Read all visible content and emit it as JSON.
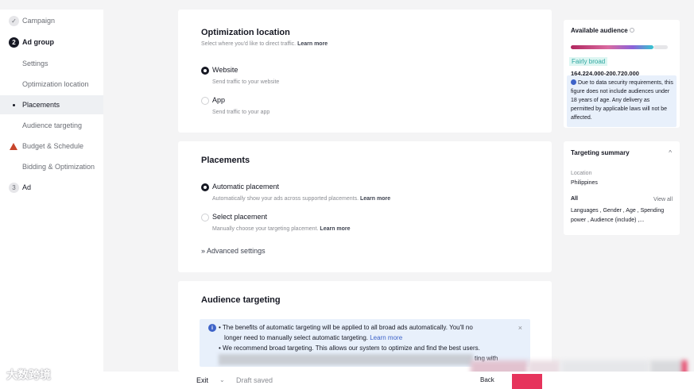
{
  "sidebar": {
    "campaign": {
      "label": "Campaign",
      "icon": "check-icon"
    },
    "ad_group": {
      "label": "Ad group",
      "step": "2"
    },
    "items": [
      {
        "label": "Settings"
      },
      {
        "label": "Optimization location"
      },
      {
        "label": "Placements"
      },
      {
        "label": "Audience targeting"
      },
      {
        "label": "Budget & Schedule",
        "icon": "warning-icon"
      },
      {
        "label": "Bidding & Optimization"
      }
    ],
    "ad": {
      "label": "Ad",
      "step": "3"
    }
  },
  "optimization_location": {
    "title": "Optimization location",
    "hint": "Select where you'd like to direct traffic.",
    "hint_link": "Learn more",
    "options": [
      {
        "label": "Website",
        "sub": "Send traffic to your website",
        "selected": true
      },
      {
        "label": "App",
        "sub": "Send traffic to your app",
        "selected": false
      }
    ]
  },
  "placements": {
    "title": "Placements",
    "options": [
      {
        "label": "Automatic placement",
        "sub": "Automatically show your ads across supported placements.",
        "link": "Learn more",
        "selected": true
      },
      {
        "label": "Select placement",
        "sub": "Manually choose your targeting placement.",
        "link": "Learn more",
        "selected": false
      }
    ],
    "advanced": "Advanced settings"
  },
  "audience_targeting": {
    "title": "Audience targeting",
    "info_line1": "The benefits of automatic targeting will be applied to all broad ads automatically. You'll no",
    "info_line2a": "longer need to manually select automatic targeting.",
    "info_line2_link": "Learn more",
    "info_line3": "We recommend broad targeting. This allows our system to optimize and find the best users.",
    "info_line4_fragment": "ting with"
  },
  "available_audience": {
    "title": "Available audience",
    "level": "Fairly broad",
    "range": "164,224,000-200,720,000",
    "note": "Due to data security requirements, this figure does not include audiences under 18 years of age. Any delivery as permitted by applicable laws will not be affected."
  },
  "targeting_summary": {
    "title": "Targeting summary",
    "location_label": "Location",
    "location_value": "Philippines",
    "all_label": "All",
    "view_all": "View all",
    "details": "Languages , Gender , Age , Spending power , Audience (include) ,..."
  },
  "footer": {
    "exit": "Exit",
    "draft_status": "Draft saved",
    "back": "Back"
  },
  "watermark": "大数跨境",
  "colors": {
    "accent": "#e6345c",
    "info_bg": "#e8f0fb",
    "warning": "#c8452b"
  }
}
